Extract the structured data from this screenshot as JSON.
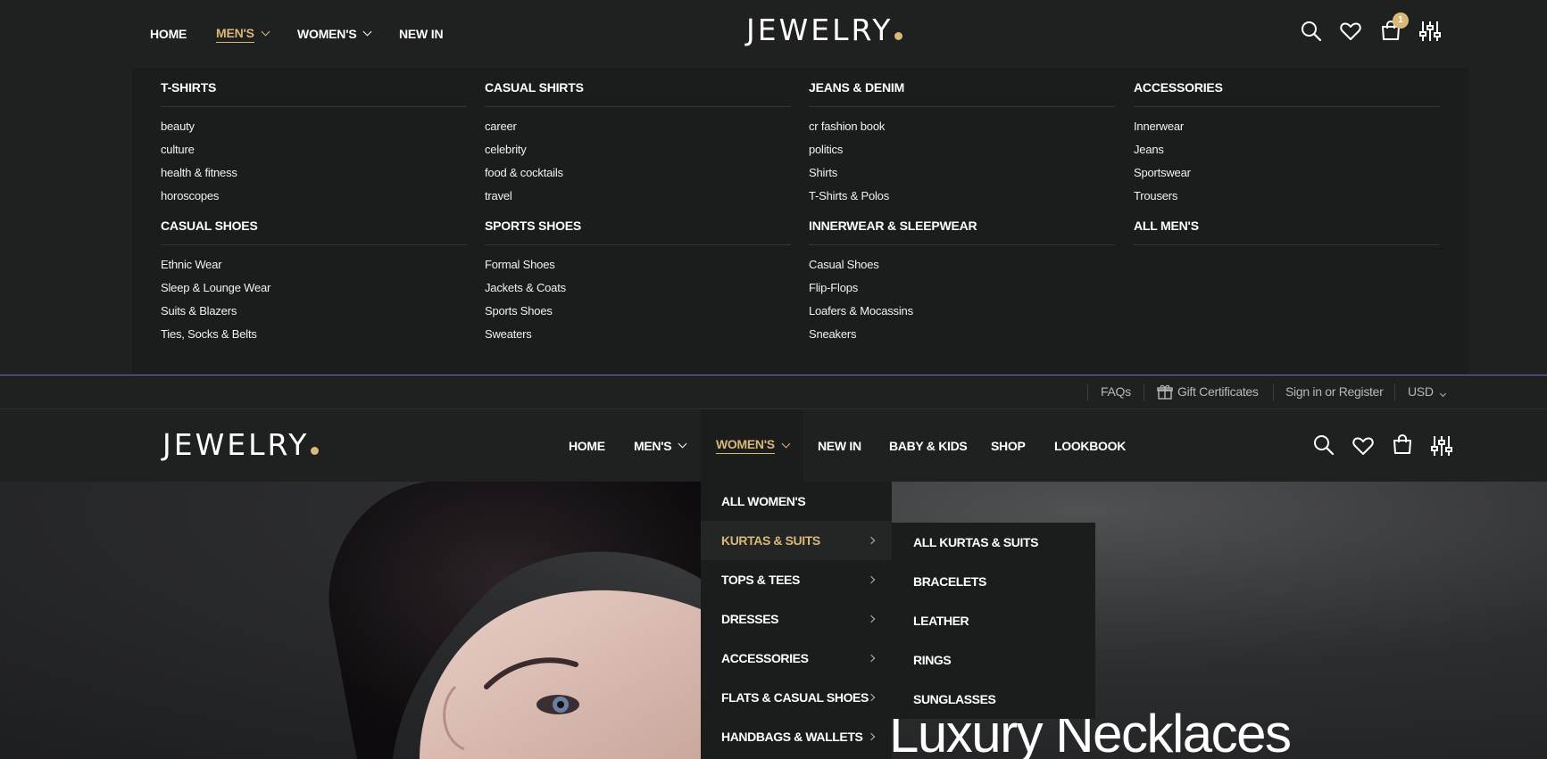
{
  "header_top": {
    "nav": [
      "HOME",
      "MEN'S",
      "WOMEN'S",
      "NEW IN"
    ],
    "logo": "JEWELRY",
    "cart_count": "1"
  },
  "mega_menu": {
    "columns": [
      {
        "groups": [
          {
            "heading": "T-SHIRTS",
            "items": [
              "beauty",
              "culture",
              "health & fitness",
              "horoscopes"
            ]
          },
          {
            "heading": "CASUAL SHOES",
            "items": [
              "Ethnic Wear",
              "Sleep & Lounge Wear",
              "Suits & Blazers",
              "Ties, Socks & Belts"
            ]
          }
        ]
      },
      {
        "groups": [
          {
            "heading": "CASUAL SHIRTS",
            "items": [
              "career",
              "celebrity",
              "food & cocktails",
              "travel"
            ]
          },
          {
            "heading": "SPORTS SHOES",
            "items": [
              "Formal Shoes",
              "Jackets & Coats",
              "Sports Shoes",
              "Sweaters"
            ]
          }
        ]
      },
      {
        "groups": [
          {
            "heading": "JEANS & DENIM",
            "items": [
              "cr fashion book",
              "politics",
              "Shirts",
              "T-Shirts & Polos"
            ]
          },
          {
            "heading": "INNERWEAR & SLEEPWEAR",
            "items": [
              "Casual Shoes",
              "Flip-Flops",
              "Loafers & Mocassins",
              "Sneakers"
            ]
          }
        ]
      },
      {
        "groups": [
          {
            "heading": "ACCESSORIES",
            "items": [
              "Innerwear",
              "Jeans",
              "Sportswear",
              "Trousers"
            ]
          },
          {
            "heading": "ALL MEN'S",
            "items": []
          }
        ]
      }
    ]
  },
  "topbar": {
    "faqs": "FAQs",
    "gift": "Gift Certificates",
    "signin": "Sign in or Register",
    "currency": "USD"
  },
  "header_second": {
    "logo": "JEWELRY",
    "nav": [
      "HOME",
      "MEN'S",
      "WOMEN'S",
      "NEW IN",
      "BABY & KIDS",
      "SHOP",
      "LOOKBOOK"
    ]
  },
  "womens_dropdown": {
    "items": [
      "ALL WOMEN'S",
      "KURTAS & SUITS",
      "TOPS & TEES",
      "DRESSES",
      "ACCESSORIES",
      "FLATS & CASUAL SHOES",
      "HANDBAGS & WALLETS"
    ],
    "highlighted": "KURTAS & SUITS"
  },
  "kurtas_submenu": {
    "items": [
      "ALL KURTAS & SUITS",
      "BRACELETS",
      "LEATHER",
      "RINGS",
      "SUNGLASSES"
    ]
  },
  "hero": {
    "title": "Luxury Necklaces"
  },
  "colors": {
    "accent": "#d9b878",
    "background": "#1f2020",
    "panel": "#1b1c1c"
  }
}
